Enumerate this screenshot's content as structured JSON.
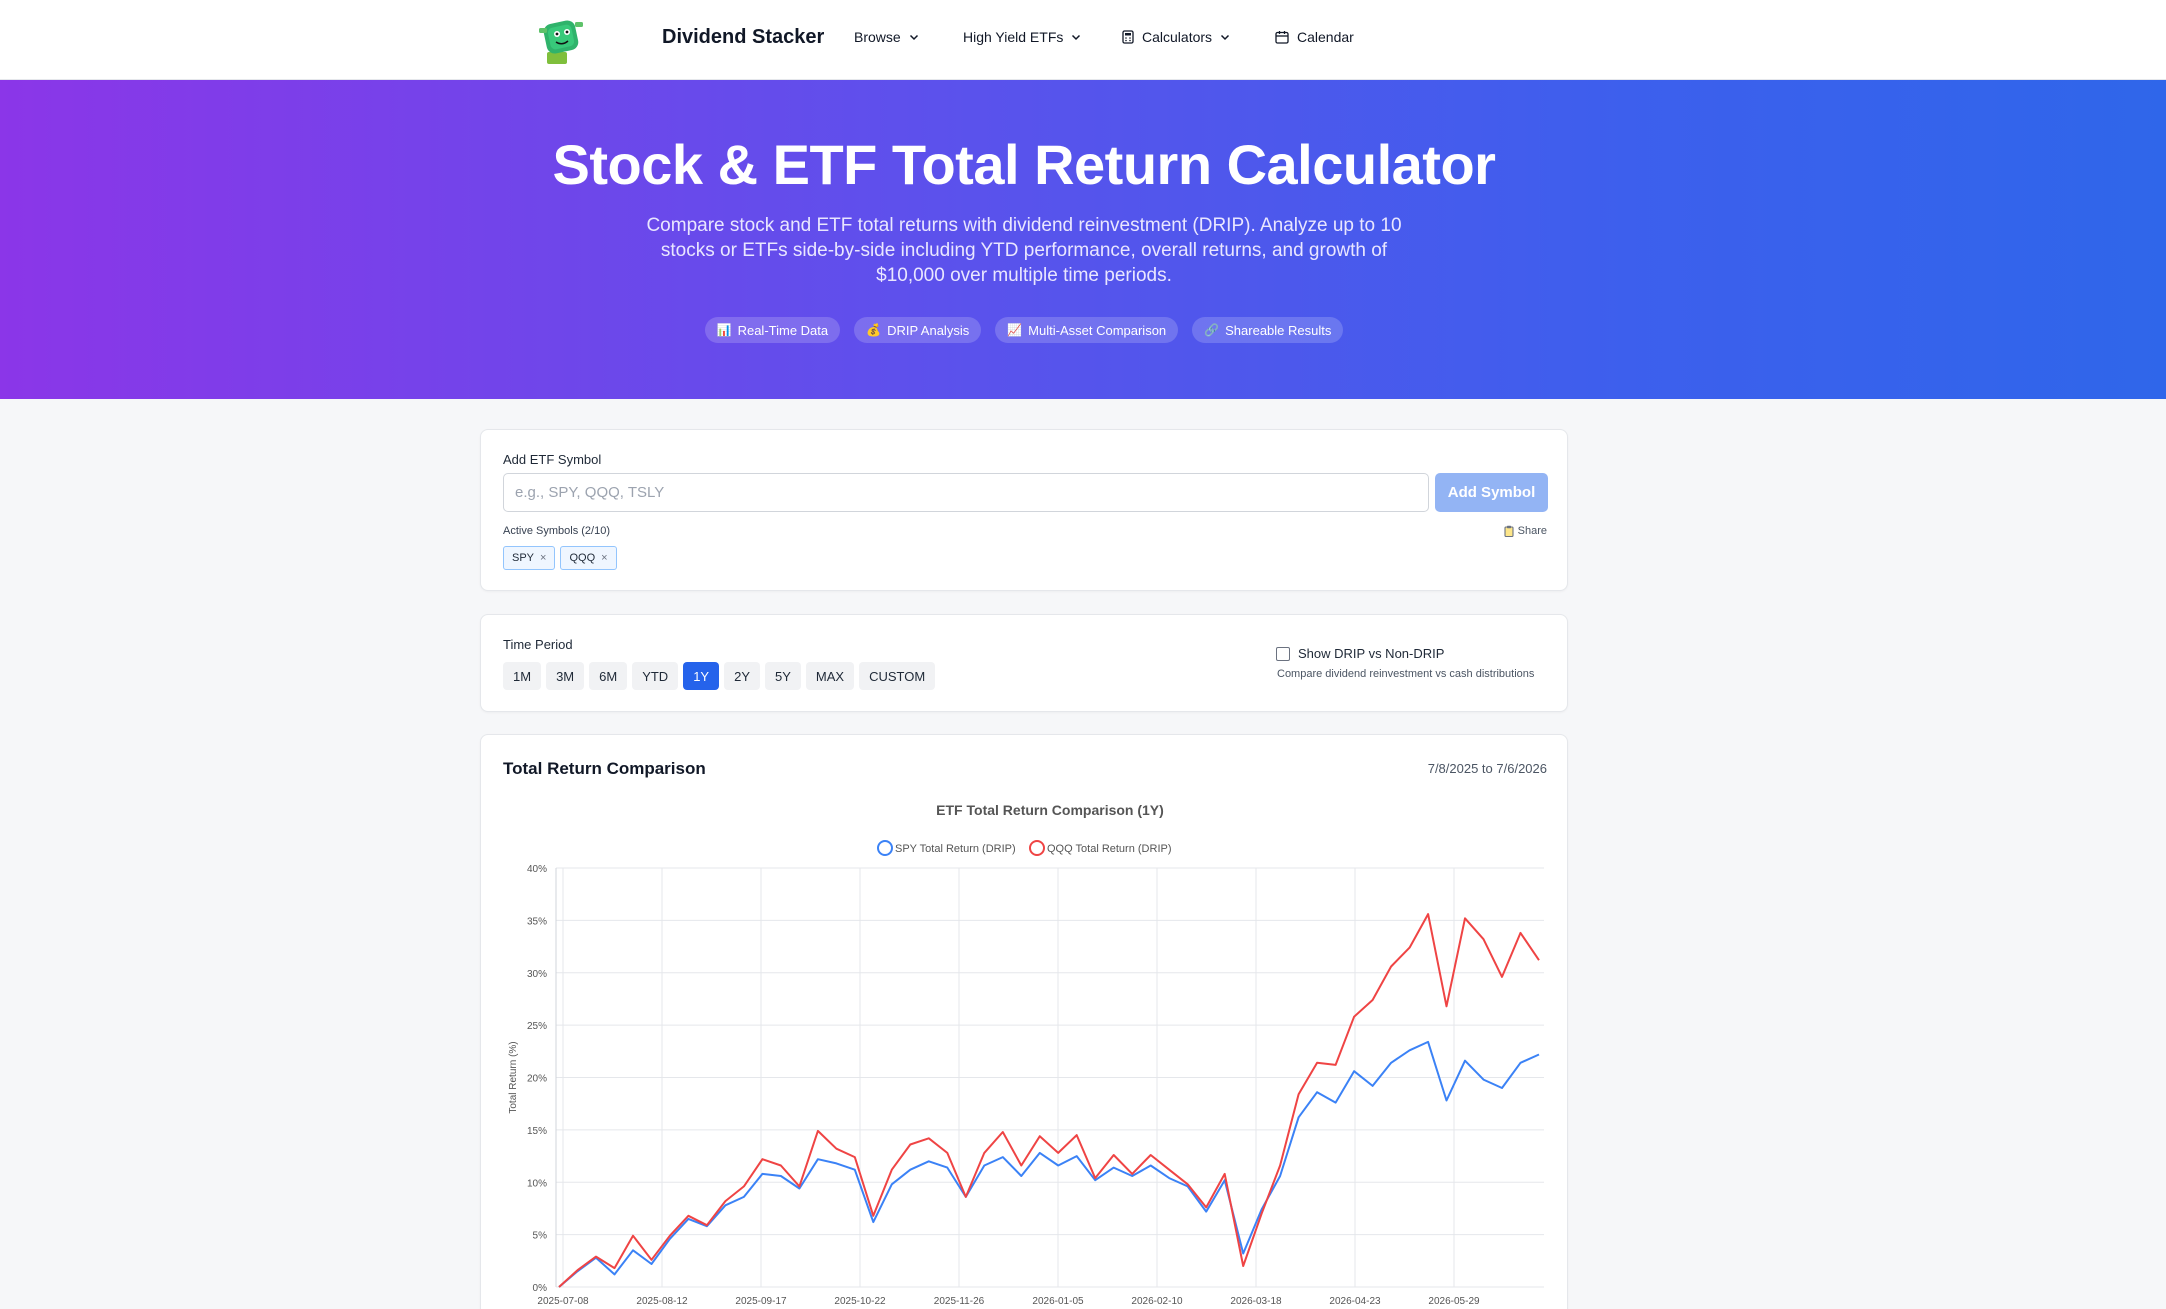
{
  "nav": {
    "brand": "Dividend Stacker",
    "items": [
      {
        "label": "Browse",
        "icon": "chevron-down-icon"
      },
      {
        "label": "High Yield ETFs",
        "icon": "chevron-down-icon"
      },
      {
        "label": "Calculators",
        "icon": "calculator-icon"
      },
      {
        "label": "Calendar",
        "icon": "calendar-icon"
      }
    ]
  },
  "hero": {
    "title": "Stock & ETF Total Return Calculator",
    "subtitle": "Compare stock and ETF total returns with dividend reinvestment (DRIP). Analyze up to 10 stocks or ETFs side-by-side including YTD performance, overall returns, and growth of $10,000 over multiple time periods.",
    "features": [
      {
        "icon": "📊",
        "label": "Real-Time Data"
      },
      {
        "icon": "💰",
        "label": "DRIP Analysis"
      },
      {
        "icon": "📈",
        "label": "Multi-Asset Comparison"
      },
      {
        "icon": "🔗",
        "label": "Shareable Results"
      }
    ]
  },
  "symbol_card": {
    "label": "Add ETF Symbol",
    "placeholder": "e.g., SPY, QQQ, TSLY",
    "add_button": "Add Symbol",
    "active_label": "Active Symbols (2/10)",
    "share_label": "Share",
    "symbols": [
      "SPY",
      "QQQ"
    ],
    "remove_glyph": "×"
  },
  "period_card": {
    "label": "Time Period",
    "periods": [
      "1M",
      "3M",
      "6M",
      "YTD",
      "1Y",
      "2Y",
      "5Y",
      "MAX",
      "CUSTOM"
    ],
    "active_period": "1Y",
    "drip_toggle_label": "Show DRIP vs Non-DRIP",
    "drip_toggle_checked": false,
    "drip_note": "Compare dividend reinvestment vs cash distributions"
  },
  "chart_card": {
    "title": "Total Return Comparison",
    "date_range": "7/8/2025 to 7/6/2026"
  },
  "colors": {
    "spy": "#3b82f6",
    "qqq": "#ef4444",
    "active_button": "#2563eb"
  },
  "chart_data": {
    "type": "line",
    "title": "ETF Total Return Comparison (1Y)",
    "ylabel": "Total Return (%)",
    "ylim": [
      0,
      40
    ],
    "yticks": [
      0,
      5,
      10,
      15,
      20,
      25,
      30,
      35,
      40
    ],
    "ytick_suffix": "%",
    "x_labels": [
      "2025-07-08",
      "2025-08-12",
      "2025-09-17",
      "2025-10-22",
      "2025-11-26",
      "2026-01-05",
      "2026-02-10",
      "2026-03-18",
      "2026-04-23",
      "2026-05-29"
    ],
    "legend_position": "top-center",
    "grid": true,
    "series": [
      {
        "name": "SPY Total Return (DRIP)",
        "color": "#3b82f6",
        "values": [
          0,
          1.5,
          2.8,
          1.2,
          3.5,
          2.2,
          4.6,
          6.5,
          5.8,
          7.8,
          8.6,
          10.8,
          10.6,
          9.4,
          12.2,
          11.8,
          11.2,
          6.2,
          9.8,
          11.2,
          12.0,
          11.4,
          8.6,
          11.6,
          12.4,
          10.6,
          12.8,
          11.6,
          12.5,
          10.2,
          11.4,
          10.6,
          11.6,
          10.4,
          9.6,
          7.2,
          10.2,
          3.2,
          7.4,
          10.6,
          16.2,
          18.6,
          17.6,
          20.6,
          19.2,
          21.4,
          22.6,
          23.4,
          17.8,
          21.6,
          19.8,
          19.0,
          21.4,
          22.2
        ]
      },
      {
        "name": "QQQ Total Return (DRIP)",
        "color": "#ef4444",
        "values": [
          0,
          1.6,
          2.9,
          1.8,
          4.9,
          2.6,
          4.9,
          6.8,
          5.9,
          8.2,
          9.6,
          12.2,
          11.6,
          9.6,
          14.9,
          13.2,
          12.4,
          6.8,
          11.2,
          13.6,
          14.2,
          12.8,
          8.6,
          12.8,
          14.8,
          11.6,
          14.4,
          12.8,
          14.5,
          10.4,
          12.6,
          10.8,
          12.6,
          11.2,
          9.8,
          7.6,
          10.8,
          2.0,
          7.0,
          11.6,
          18.4,
          21.4,
          21.2,
          25.8,
          27.4,
          30.6,
          32.4,
          35.6,
          26.8,
          35.2,
          33.2,
          29.6,
          33.8,
          31.2
        ]
      }
    ]
  }
}
